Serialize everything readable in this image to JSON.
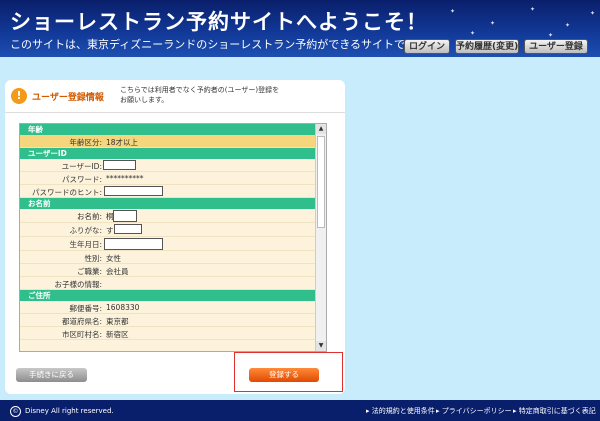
{
  "header": {
    "title": "ショーレストラン予約サイトへようこそ！",
    "subtitle": "このサイトは、東京ディズニーランドのショーレストラン予約ができるサイトです。",
    "buttons": {
      "login": "ログイン",
      "history": "予約履歴(変更)",
      "register": "ユーザー登録"
    }
  },
  "card": {
    "title": "ユーザー登録情報",
    "note": "こちらでは利用者でなく予約者の(ユーザー)登録を\nお願いします。",
    "sections": {
      "age": "年齢",
      "user_id": "ユーザーID",
      "name": "お名前",
      "address": "ご住所"
    },
    "fields": {
      "age_category_label": "年齢区分:",
      "age_category_value": "18才以上",
      "user_id_label": "ユーザーID:",
      "password_label": "パスワード:",
      "password_value": "**********",
      "password_hint_label": "パスワードのヒント:",
      "name_label": "お名前:",
      "name_prefix": "桐",
      "kana_label": "ふりがな:",
      "kana_prefix": "す",
      "birth_label": "生年月日:",
      "gender_label": "性別:",
      "gender_value": "女性",
      "occupation_label": "ご職業:",
      "occupation_value": "会社員",
      "children_label": "お子様の情報:",
      "postal_label": "郵便番号:",
      "postal_value": "1608330",
      "prefecture_label": "都道府県名:",
      "prefecture_value": "東京都",
      "city_label": "市区町村名:",
      "city_value": "新宿区"
    },
    "back_button": "手続きに戻る",
    "register_button": "登録する"
  },
  "footer": {
    "copyright": "Disney All right reserved.",
    "links": [
      "法的規約と使用条件",
      "プライバシーポリシー",
      "特定商取引に基づく表記"
    ]
  },
  "colors": {
    "header": "#0a1f6b",
    "section": "#2fbe8c",
    "field_bg": "#fdf3dc",
    "highlight": "#f5d67c",
    "accent": "#e04a00",
    "panel_bg": "#c9ecfc"
  }
}
